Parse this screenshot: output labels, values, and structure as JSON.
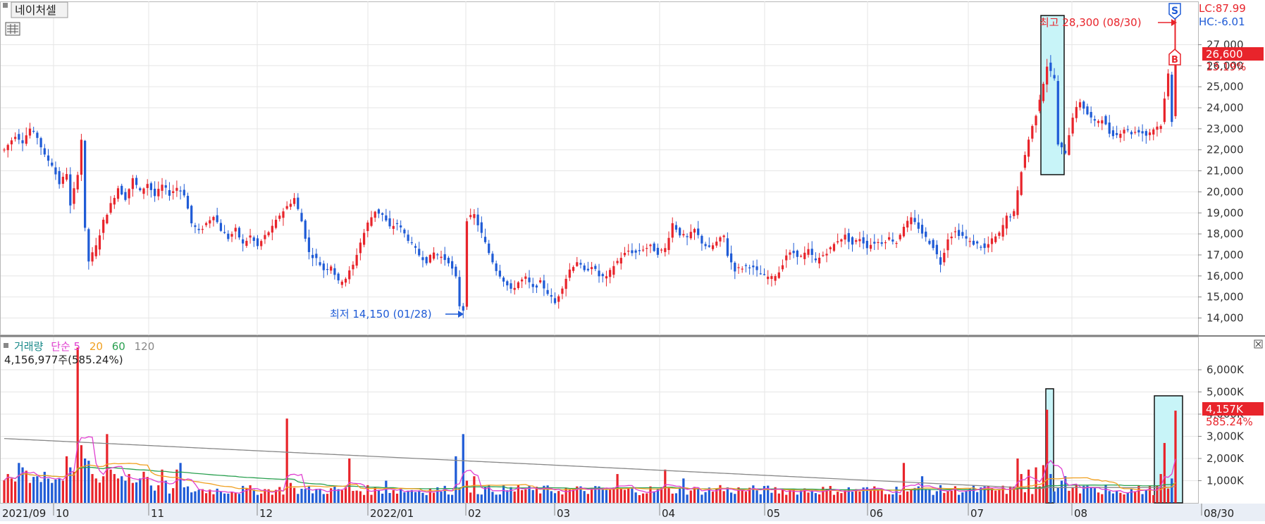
{
  "stock_label": "네이처셀",
  "price_panel": {
    "lc_label": "LC:87.99",
    "hc_label": "HC:-6.01",
    "current_price": "26,600",
    "current_change": "13.19%",
    "high_annotation": "최고 28,300 (08/30)",
    "low_annotation": "최저 14,150 (01/28)",
    "sell_marker": "S",
    "buy_marker": "B"
  },
  "volume_panel": {
    "legend_title": "거래량",
    "legend_ma_label": "단순 5",
    "legend_ma_20": "20",
    "legend_ma_60": "60",
    "legend_ma_120": "120",
    "current_volume_text": "4,156,977주(585.24%)",
    "current_volume": "4,157K",
    "current_volume_pct": "585.24%"
  },
  "colors": {
    "up": "#e8242b",
    "down": "#1f5bd6",
    "ma5": "#e040d0",
    "ma20": "#f0a020",
    "ma60": "#2aa050",
    "ma120": "#888888",
    "label_bg": "#e8242b",
    "highlight": "#c8f4f8"
  },
  "chart_data": [
    {
      "type": "candlestick",
      "title": "",
      "xlabel": "",
      "ylabel": "",
      "ylim": [
        13500,
        29000
      ],
      "y_ticks": [
        14000,
        15000,
        16000,
        17000,
        18000,
        19000,
        20000,
        21000,
        22000,
        23000,
        24000,
        25000,
        26000,
        27000
      ],
      "y_tick_labels": [
        "14,000",
        "15,000",
        "16,000",
        "17,000",
        "18,000",
        "19,000",
        "20,000",
        "21,000",
        "22,000",
        "23,000",
        "24,000",
        "25,000",
        "26,000",
        "27,000"
      ],
      "x_tick_labels": [
        "2021/09",
        "10",
        "11",
        "12",
        "2022/01",
        "02",
        "03",
        "04",
        "05",
        "06",
        "07",
        "08",
        "08/30"
      ],
      "anchors": [
        [
          0,
          22000
        ],
        [
          3,
          22700
        ],
        [
          5,
          22400
        ],
        [
          7,
          23000
        ],
        [
          9,
          22600
        ],
        [
          11,
          21700
        ],
        [
          13,
          21300
        ],
        [
          15,
          20400
        ],
        [
          17,
          20900
        ],
        [
          18,
          19300
        ],
        [
          20,
          20900
        ],
        [
          21,
          22500
        ],
        [
          22,
          18200
        ],
        [
          23,
          16700
        ],
        [
          25,
          17400
        ],
        [
          27,
          18600
        ],
        [
          29,
          19400
        ],
        [
          31,
          20200
        ],
        [
          33,
          19700
        ],
        [
          35,
          20600
        ],
        [
          37,
          20000
        ],
        [
          39,
          20400
        ],
        [
          41,
          19800
        ],
        [
          43,
          20300
        ],
        [
          45,
          19900
        ],
        [
          47,
          20200
        ],
        [
          49,
          19900
        ],
        [
          51,
          18500
        ],
        [
          53,
          18100
        ],
        [
          55,
          18500
        ],
        [
          57,
          18900
        ],
        [
          59,
          18200
        ],
        [
          61,
          17800
        ],
        [
          63,
          18200
        ],
        [
          65,
          17500
        ],
        [
          67,
          17900
        ],
        [
          69,
          17400
        ],
        [
          71,
          17900
        ],
        [
          73,
          18300
        ],
        [
          75,
          18900
        ],
        [
          77,
          19300
        ],
        [
          79,
          19700
        ],
        [
          81,
          18600
        ],
        [
          83,
          17100
        ],
        [
          85,
          16800
        ],
        [
          87,
          16300
        ],
        [
          89,
          16500
        ],
        [
          91,
          15700
        ],
        [
          93,
          15900
        ],
        [
          95,
          16500
        ],
        [
          97,
          17600
        ],
        [
          99,
          18500
        ],
        [
          101,
          19100
        ],
        [
          103,
          18900
        ],
        [
          105,
          18300
        ],
        [
          107,
          18500
        ],
        [
          109,
          18000
        ],
        [
          111,
          17500
        ],
        [
          113,
          17000
        ],
        [
          115,
          16700
        ],
        [
          117,
          17100
        ],
        [
          119,
          16900
        ],
        [
          121,
          16700
        ],
        [
          123,
          15900
        ],
        [
          124,
          14600
        ],
        [
          125,
          14400
        ],
        [
          126,
          18700
        ],
        [
          128,
          18900
        ],
        [
          130,
          18000
        ],
        [
          132,
          17100
        ],
        [
          134,
          16300
        ],
        [
          136,
          15800
        ],
        [
          138,
          15300
        ],
        [
          140,
          15700
        ],
        [
          142,
          15900
        ],
        [
          144,
          15400
        ],
        [
          146,
          15700
        ],
        [
          148,
          15200
        ],
        [
          150,
          14700
        ],
        [
          152,
          15500
        ],
        [
          154,
          16300
        ],
        [
          156,
          16700
        ],
        [
          158,
          16200
        ],
        [
          160,
          16500
        ],
        [
          162,
          16000
        ],
        [
          164,
          15900
        ],
        [
          166,
          16500
        ],
        [
          168,
          16900
        ],
        [
          170,
          17200
        ],
        [
          172,
          17100
        ],
        [
          174,
          17300
        ],
        [
          176,
          17400
        ],
        [
          178,
          17100
        ],
        [
          180,
          17300
        ],
        [
          182,
          18500
        ],
        [
          184,
          18000
        ],
        [
          186,
          17800
        ],
        [
          188,
          18200
        ],
        [
          190,
          17600
        ],
        [
          192,
          17300
        ],
        [
          194,
          17600
        ],
        [
          196,
          17900
        ],
        [
          197,
          17000
        ],
        [
          199,
          16300
        ],
        [
          201,
          16400
        ],
        [
          203,
          16500
        ],
        [
          205,
          16200
        ],
        [
          207,
          16000
        ],
        [
          209,
          15900
        ],
        [
          211,
          16200
        ],
        [
          213,
          17000
        ],
        [
          215,
          17100
        ],
        [
          217,
          16900
        ],
        [
          219,
          17200
        ],
        [
          221,
          16700
        ],
        [
          223,
          17000
        ],
        [
          225,
          17300
        ],
        [
          227,
          17700
        ],
        [
          229,
          17900
        ],
        [
          231,
          17500
        ],
        [
          233,
          17800
        ],
        [
          235,
          17400
        ],
        [
          237,
          17600
        ],
        [
          239,
          17600
        ],
        [
          241,
          17800
        ],
        [
          243,
          17600
        ],
        [
          245,
          18400
        ],
        [
          247,
          18700
        ],
        [
          249,
          18300
        ],
        [
          251,
          17800
        ],
        [
          253,
          17400
        ],
        [
          255,
          16600
        ],
        [
          257,
          17800
        ],
        [
          259,
          18100
        ],
        [
          261,
          17900
        ],
        [
          263,
          17600
        ],
        [
          265,
          17500
        ],
        [
          267,
          17300
        ],
        [
          269,
          17700
        ],
        [
          271,
          18000
        ],
        [
          273,
          18800
        ],
        [
          275,
          19000
        ],
        [
          277,
          21000
        ],
        [
          279,
          22500
        ],
        [
          281,
          23700
        ],
        [
          283,
          25200
        ],
        [
          284,
          26000
        ],
        [
          286,
          25400
        ],
        [
          287,
          22200
        ],
        [
          289,
          21900
        ],
        [
          291,
          23600
        ],
        [
          293,
          24300
        ],
        [
          295,
          23700
        ],
        [
          297,
          23300
        ],
        [
          299,
          23500
        ],
        [
          301,
          22800
        ],
        [
          303,
          22700
        ],
        [
          305,
          23000
        ],
        [
          307,
          22800
        ],
        [
          309,
          22900
        ],
        [
          311,
          22700
        ],
        [
          313,
          23000
        ],
        [
          315,
          23200
        ],
        [
          317,
          25600
        ],
        [
          318,
          23400
        ],
        [
          319,
          26600
        ]
      ],
      "visible_labels": {
        "high": {
          "x": "08/30",
          "value": 28300
        },
        "low": {
          "x": "01/28",
          "value": 14150
        },
        "current": 26600,
        "current_change_pct": 13.19
      }
    },
    {
      "type": "bar",
      "title": "",
      "xlabel": "",
      "ylabel": "",
      "ylim": [
        0,
        7000
      ],
      "y_ticks": [
        1000,
        2000,
        3000,
        4000,
        5000,
        6000
      ],
      "y_tick_labels": [
        "1,000K",
        "2,000K",
        "3,000K",
        "4,000K",
        "5,000K",
        "6,000K"
      ],
      "unit": "K shares",
      "base_volume": 500,
      "spikes": [
        [
          1,
          1300
        ],
        [
          2,
          1100
        ],
        [
          4,
          1800
        ],
        [
          5,
          1600
        ],
        [
          7,
          900
        ],
        [
          9,
          1200
        ],
        [
          11,
          1400
        ],
        [
          13,
          900
        ],
        [
          15,
          1100
        ],
        [
          17,
          2100
        ],
        [
          18,
          1600
        ],
        [
          19,
          1400
        ],
        [
          20,
          7000
        ],
        [
          21,
          2600
        ],
        [
          22,
          2000
        ],
        [
          23,
          1900
        ],
        [
          24,
          1300
        ],
        [
          25,
          1100
        ],
        [
          27,
          1200
        ],
        [
          28,
          3100
        ],
        [
          29,
          1500
        ],
        [
          30,
          1300
        ],
        [
          31,
          1100
        ],
        [
          32,
          1200
        ],
        [
          33,
          1000
        ],
        [
          34,
          1300
        ],
        [
          35,
          900
        ],
        [
          37,
          1100
        ],
        [
          43,
          1500
        ],
        [
          44,
          1000
        ],
        [
          47,
          1500
        ],
        [
          48,
          1800
        ],
        [
          77,
          3800
        ],
        [
          78,
          900
        ],
        [
          94,
          2000
        ],
        [
          104,
          1000
        ],
        [
          123,
          2100
        ],
        [
          125,
          3100
        ],
        [
          126,
          1000
        ],
        [
          128,
          1200
        ],
        [
          140,
          800
        ],
        [
          167,
          1300
        ],
        [
          180,
          1500
        ],
        [
          185,
          1100
        ],
        [
          195,
          800
        ],
        [
          245,
          1800
        ],
        [
          250,
          1200
        ],
        [
          276,
          2000
        ],
        [
          277,
          1300
        ],
        [
          279,
          1500
        ],
        [
          281,
          1600
        ],
        [
          283,
          1700
        ],
        [
          284,
          4200
        ],
        [
          285,
          1300
        ],
        [
          288,
          1000
        ],
        [
          289,
          1200
        ],
        [
          292,
          800
        ],
        [
          300,
          800
        ],
        [
          315,
          1300
        ],
        [
          316,
          2700
        ],
        [
          318,
          1100
        ],
        [
          319,
          4157
        ]
      ],
      "moving_averages": [
        "단순 5",
        "20",
        "60",
        "120"
      ],
      "legend_placement": "top-left"
    }
  ]
}
